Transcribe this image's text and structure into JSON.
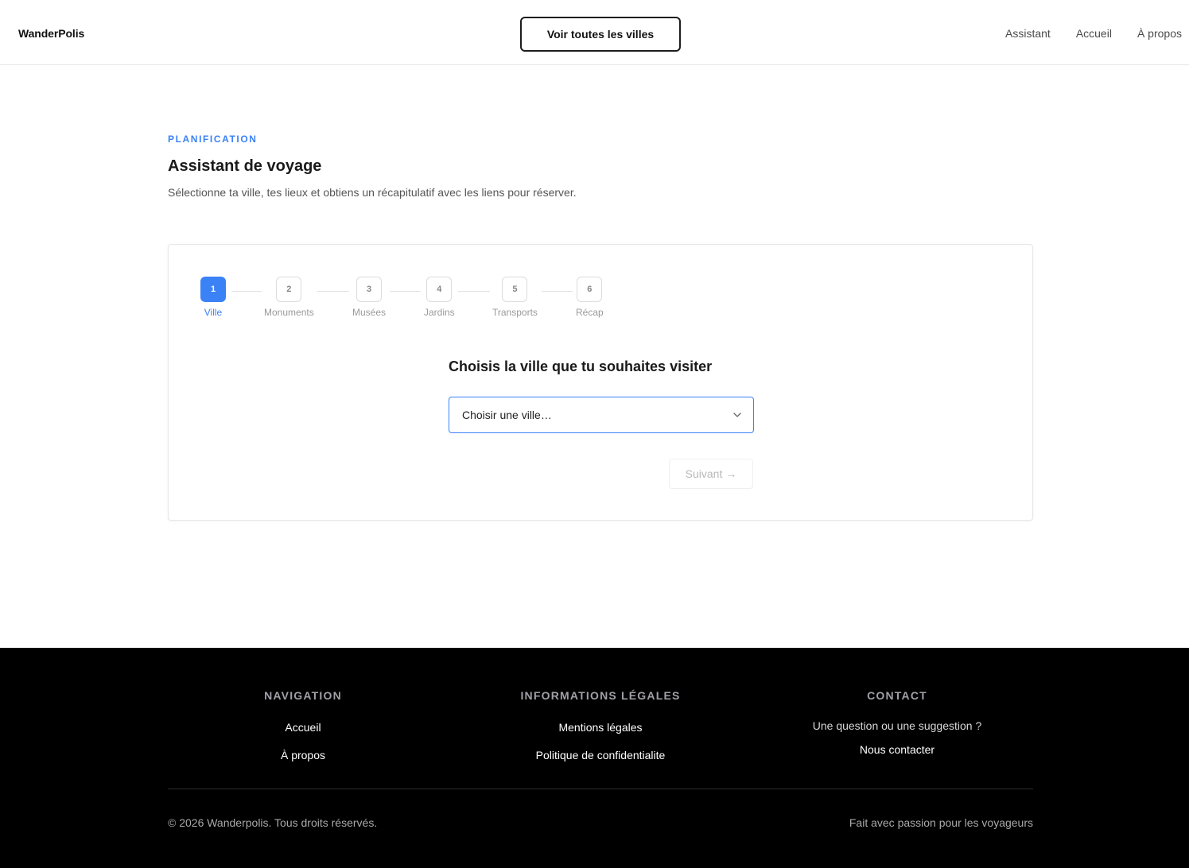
{
  "header": {
    "brand": "WanderPolis",
    "cta_label": "Voir toutes les villes",
    "nav": [
      "Assistant",
      "Accueil",
      "À propos"
    ]
  },
  "intro": {
    "eyebrow": "PLANIFICATION",
    "title": "Assistant de voyage",
    "subtitle": "Sélectionne ta ville, tes lieux et obtiens un récapitulatif avec les liens pour réserver."
  },
  "wizard": {
    "steps": [
      {
        "number": "1",
        "label": "Ville"
      },
      {
        "number": "2",
        "label": "Monuments"
      },
      {
        "number": "3",
        "label": "Musées"
      },
      {
        "number": "4",
        "label": "Jardins"
      },
      {
        "number": "5",
        "label": "Transports"
      },
      {
        "number": "6",
        "label": "Récap"
      }
    ],
    "active_step": 1,
    "question": "Choisis la ville que tu souhaites visiter",
    "select_value": "Choisir une ville…",
    "next_label": "Suivant",
    "next_arrow": "→"
  },
  "footer": {
    "nav_title": "NAVIGATION",
    "nav_links": [
      "Accueil",
      "À propos"
    ],
    "legal_title": "INFORMATIONS LÉGALES",
    "legal_links": [
      "Mentions légales",
      "Politique de confidentialite"
    ],
    "contact_title": "CONTACT",
    "contact_text": "Une question ou une suggestion ?",
    "contact_link": "Nous contacter",
    "copyright": "© 2026 Wanderpolis. Tous droits réservés.",
    "tagline": "Fait avec passion pour les voyageurs"
  },
  "colors": {
    "accent": "#3b82f6",
    "footer_bg": "#000000"
  },
  "icons": {
    "select_chevron": "chevron-down-icon"
  }
}
